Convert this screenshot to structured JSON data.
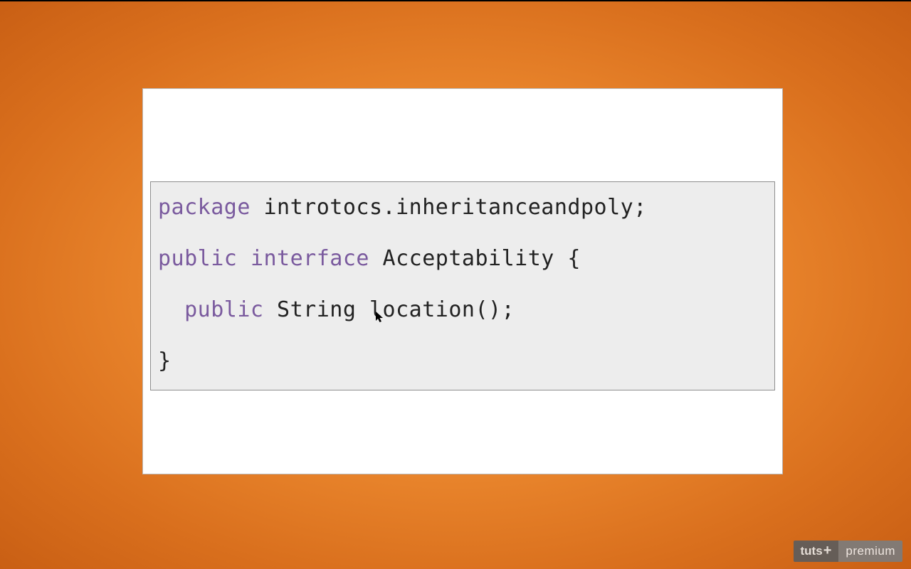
{
  "code": {
    "line1": {
      "kw": "package",
      "rest": " introtocs.inheritanceandpoly;"
    },
    "line3a": {
      "kw1": "public",
      "kw2": "interface",
      "rest": " Acceptability {"
    },
    "line5": {
      "indent": "  ",
      "kw": "public",
      "rest": " String location();"
    },
    "line7": "}"
  },
  "watermark": {
    "brand": "tuts",
    "plus": "+",
    "tier": "premium"
  }
}
